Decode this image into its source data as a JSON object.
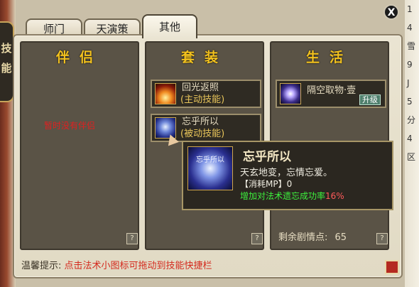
{
  "edge": {
    "left_badge": "技能",
    "right_lines": [
      "1",
      "4",
      "雪",
      "9",
      "J",
      "5",
      "分",
      "4",
      "区"
    ]
  },
  "tabs": [
    "师门",
    "天演策",
    "其他"
  ],
  "close_label": "X",
  "partner": {
    "title": "伴侣",
    "status": "暂时没有伴侣"
  },
  "suit": {
    "title": "套装",
    "skills": [
      {
        "name": "回光返照",
        "type": "(主动技能)",
        "icon": "fire-skill-icon"
      },
      {
        "name": "忘乎所以",
        "type": "(被动技能)",
        "icon": "swirl-skill-icon"
      }
    ]
  },
  "life": {
    "title": "生活",
    "skill": {
      "name": "隔空取物·壹",
      "upgrade": "升级",
      "icon": "star-skill-icon"
    },
    "plot_label": "剩余剧情点:",
    "plot_value": "65"
  },
  "help_label": "?",
  "hint": {
    "label": "温馨提示:",
    "text": "点击法术小图标可拖动到技能快捷栏"
  },
  "tooltip": {
    "title": "忘乎所以",
    "icon_text": "忘乎所以",
    "desc": "天玄地变，忘情忘爱。",
    "cost_label": "【消耗MP】",
    "cost_value": "0",
    "effect": "增加对法术遗忘成功率",
    "effect_pct": "16%"
  },
  "colors": {
    "title_gold": "#f3c21e",
    "hint_red": "#d42a1e",
    "effect_green": "#3df03d"
  }
}
